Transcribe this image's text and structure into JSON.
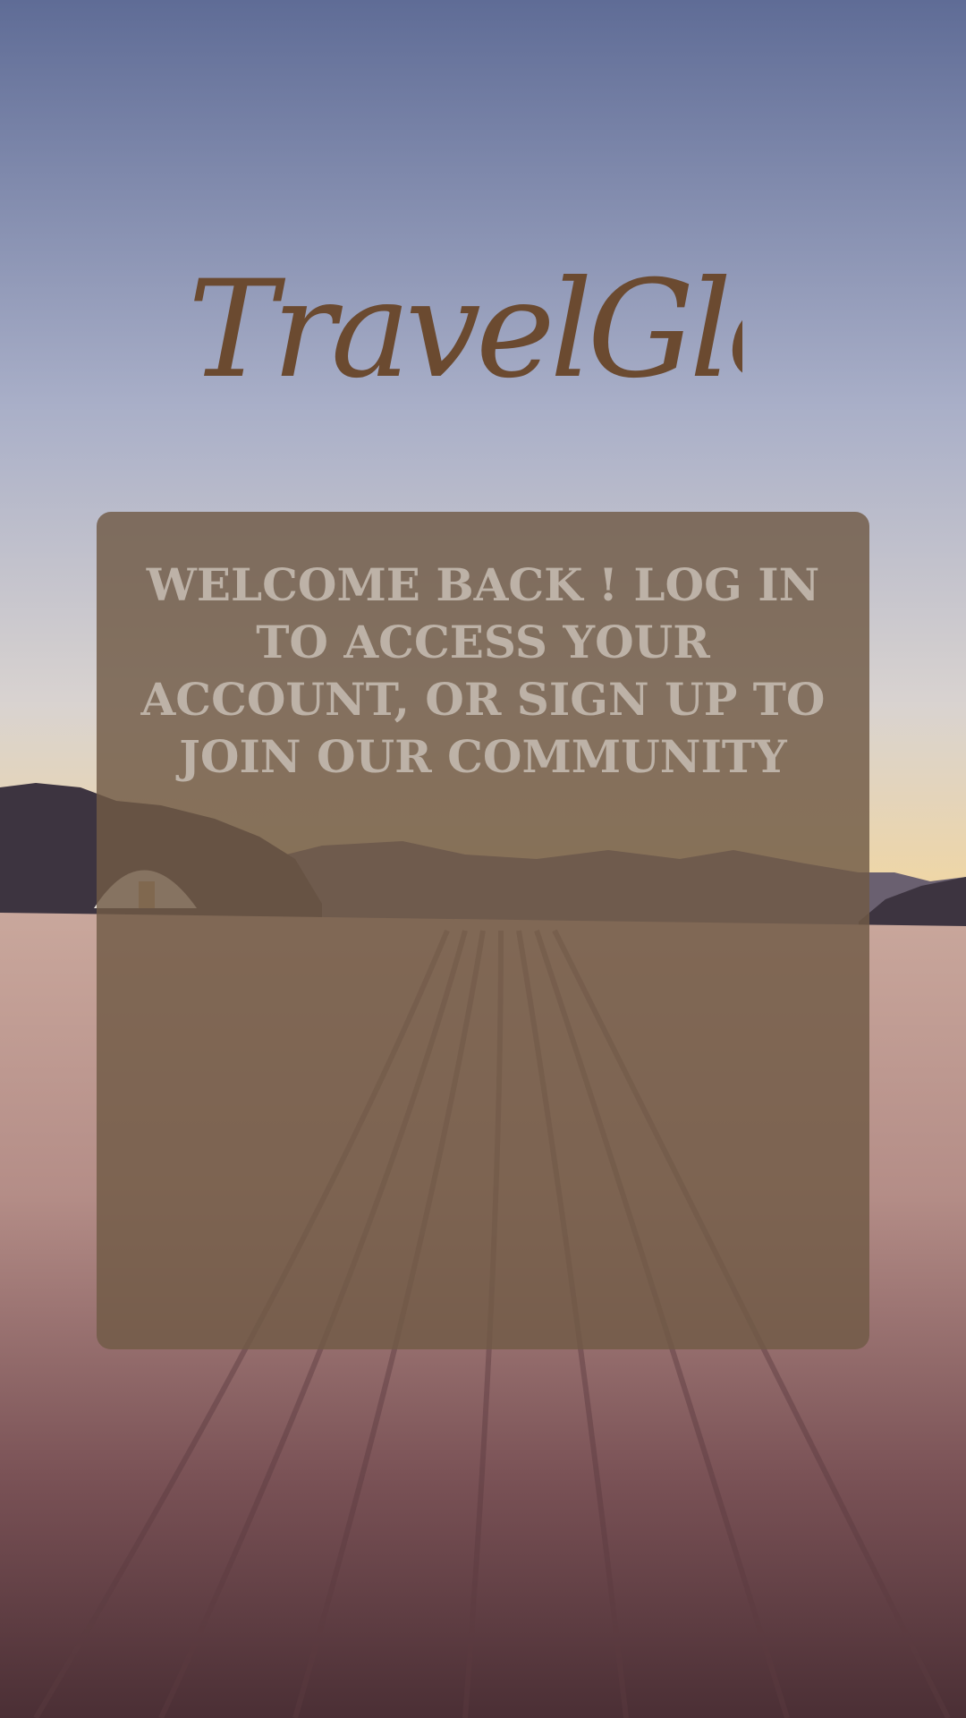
{
  "app": {
    "logo_text": "TravelGlow"
  },
  "login_card": {
    "message": "WELCOME BACK ! LOG IN TO ACCESS YOUR ACCOUNT, OR SIGN UP TO JOIN OUR COMMUNITY"
  },
  "background": {
    "icon": "desert-landscape-image",
    "colors": {
      "sky_top": "#5f6c96",
      "sky_mid": "#a9afc8",
      "horizon_glow": "#f1d6a1",
      "mountains": "#3d3440",
      "sand_light": "#b48d87",
      "sand_dark": "#4b2f35"
    }
  },
  "colors": {
    "logo": "#6b4a30",
    "card": "#705a46",
    "card_text": "#bdb2a7"
  }
}
